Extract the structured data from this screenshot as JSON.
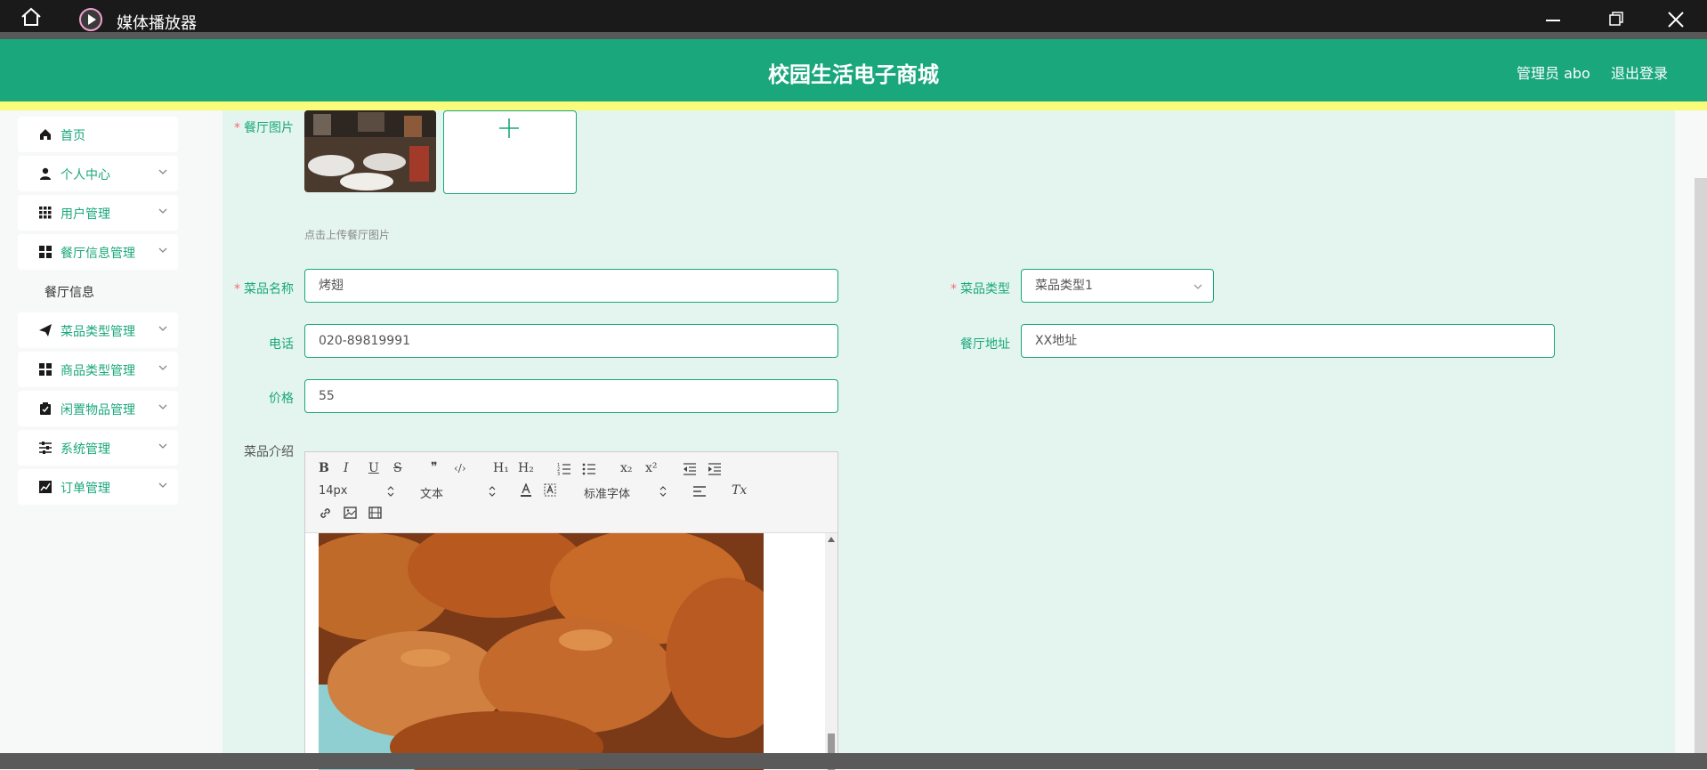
{
  "window": {
    "title": "媒体播放器"
  },
  "header": {
    "site_title": "校园生活电子商城",
    "admin": "管理员 abo",
    "logout": "退出登录"
  },
  "sidebar": {
    "items": [
      {
        "label": "首页",
        "icon": "home-icon"
      },
      {
        "label": "个人中心",
        "icon": "user-icon"
      },
      {
        "label": "用户管理",
        "icon": "grid-icon"
      },
      {
        "label": "餐厅信息管理",
        "icon": "apps-icon"
      },
      {
        "label": "菜品类型管理",
        "icon": "send-icon"
      },
      {
        "label": "商品类型管理",
        "icon": "apps-icon"
      },
      {
        "label": "闲置物品管理",
        "icon": "clipboard-icon"
      },
      {
        "label": "系统管理",
        "icon": "sliders-icon"
      },
      {
        "label": "订单管理",
        "icon": "chart-icon"
      }
    ],
    "submenu": {
      "label": "餐厅信息"
    }
  },
  "form": {
    "image": {
      "label": "餐厅图片",
      "hint": "点击上传餐厅图片"
    },
    "dish_name": {
      "label": "菜品名称",
      "value": "烤翅"
    },
    "dish_type": {
      "label": "菜品类型",
      "value": "菜品类型1"
    },
    "phone": {
      "label": "电话",
      "value": "020-89819991"
    },
    "address": {
      "label": "餐厅地址",
      "value": "XX地址"
    },
    "price": {
      "label": "价格",
      "value": "55"
    },
    "intro": {
      "label": "菜品介绍"
    }
  },
  "editor": {
    "font_size": "14px",
    "header_pick": "文本",
    "font_family": "标准字体",
    "buttons": {
      "bold": "B",
      "italic": "I",
      "underline": "U",
      "strike": "S",
      "quote": "❞",
      "code": "‹/›",
      "h1": "H₁",
      "h2": "H₂",
      "sub": "x₂",
      "sup": "x²",
      "clean": "Tx"
    }
  },
  "colors": {
    "primary": "#1aa77b",
    "header": "#1aa77b",
    "accent_strip": "#f9fb7a",
    "content_bg": "#e4f5ef",
    "required": "#f56c6c"
  }
}
